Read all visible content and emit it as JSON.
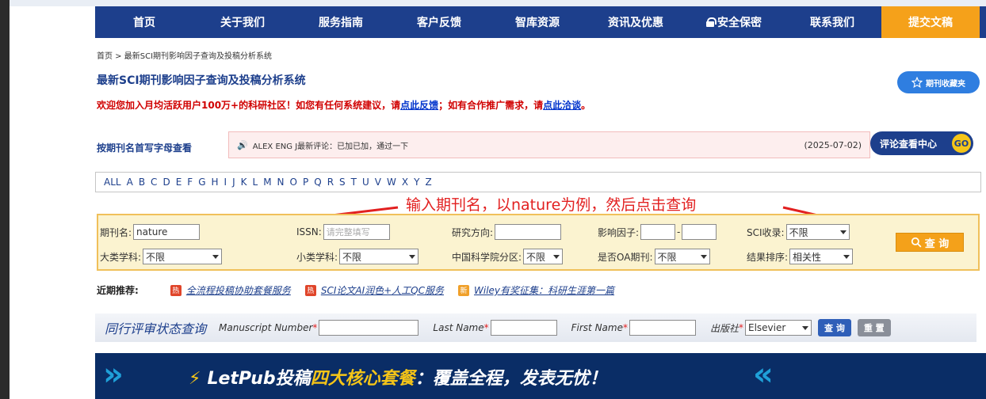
{
  "nav": {
    "items": [
      "首页",
      "关于我们",
      "服务指南",
      "客户反馈",
      "智库资源",
      "资讯及优惠",
      "安全保密",
      "联系我们"
    ],
    "submit": "提交文稿"
  },
  "breadcrumb": "首页 > 最新SCI期刊影响因子查询及投稿分析系统",
  "page_title": "最新SCI期刊影响因子查询及投稿分析系统",
  "fav_button": "期刊收藏夹",
  "notice": {
    "text1": "欢迎您加入月均活跃用户100万+的科研社区！如您有任何系统建议，请",
    "link1": "点此反馈",
    "text2": "；如有合作推广需求，请",
    "link2": "点此洽谈",
    "text3": "。"
  },
  "letter_label": "按期刊名首写字母查看",
  "comment": {
    "text": "ALEX ENG J最新评论：已加已加，通过一下",
    "date": "(2025-07-02)",
    "center_label": "评论查看中心",
    "go": "GO"
  },
  "letters": [
    "ALL",
    "A",
    "B",
    "C",
    "D",
    "E",
    "F",
    "G",
    "H",
    "I",
    "J",
    "K",
    "L",
    "M",
    "N",
    "O",
    "P",
    "Q",
    "R",
    "S",
    "T",
    "U",
    "V",
    "W",
    "X",
    "Y",
    "Z"
  ],
  "annotation": "输入期刊名，以nature为例，然后点击查询",
  "search": {
    "journal_label": "期刊名:",
    "journal_value": "nature",
    "issn_label": "ISSN:",
    "issn_placeholder": "请完整填写",
    "field_label": "研究方向:",
    "if_label": "影响因子:",
    "if_sep": "-",
    "sci_label": "SCI收录:",
    "sci_value": "不限",
    "major_label": "大类学科:",
    "major_value": "不限",
    "minor_label": "小类学科:",
    "minor_value": "不限",
    "cas_label": "中国科学院分区:",
    "cas_value": "不限",
    "oa_label": "是否OA期刊:",
    "oa_value": "不限",
    "sort_label": "结果排序:",
    "sort_value": "相关性",
    "query_button": "查 询"
  },
  "recommend": {
    "label": "近期推荐:",
    "items": [
      {
        "badge": "热",
        "text": "全流程投稿协助套餐服务"
      },
      {
        "badge": "热",
        "text": "SCI论文AI润色+人工QC服务"
      },
      {
        "badge": "新",
        "text": "Wiley有奖征集：科研生涯第一篇"
      }
    ]
  },
  "peer": {
    "title": "同行评审状态查询",
    "manuscript_label": "Manuscript Number",
    "lastname_label": "Last Name",
    "firstname_label": "First Name",
    "publisher_label": "出版社",
    "publisher_value": "Elsevier",
    "query": "查 询",
    "reset": "重 置",
    "star": "*"
  },
  "banner": {
    "bolt": "⚡",
    "text1": "LetPub投稿",
    "highlight": "四大核心套餐",
    "text2": "：覆盖全程，发表无忧！"
  },
  "colors": {
    "nav": "#1d3f8c",
    "accent": "#f5a11a",
    "arrow": "#e22020"
  }
}
